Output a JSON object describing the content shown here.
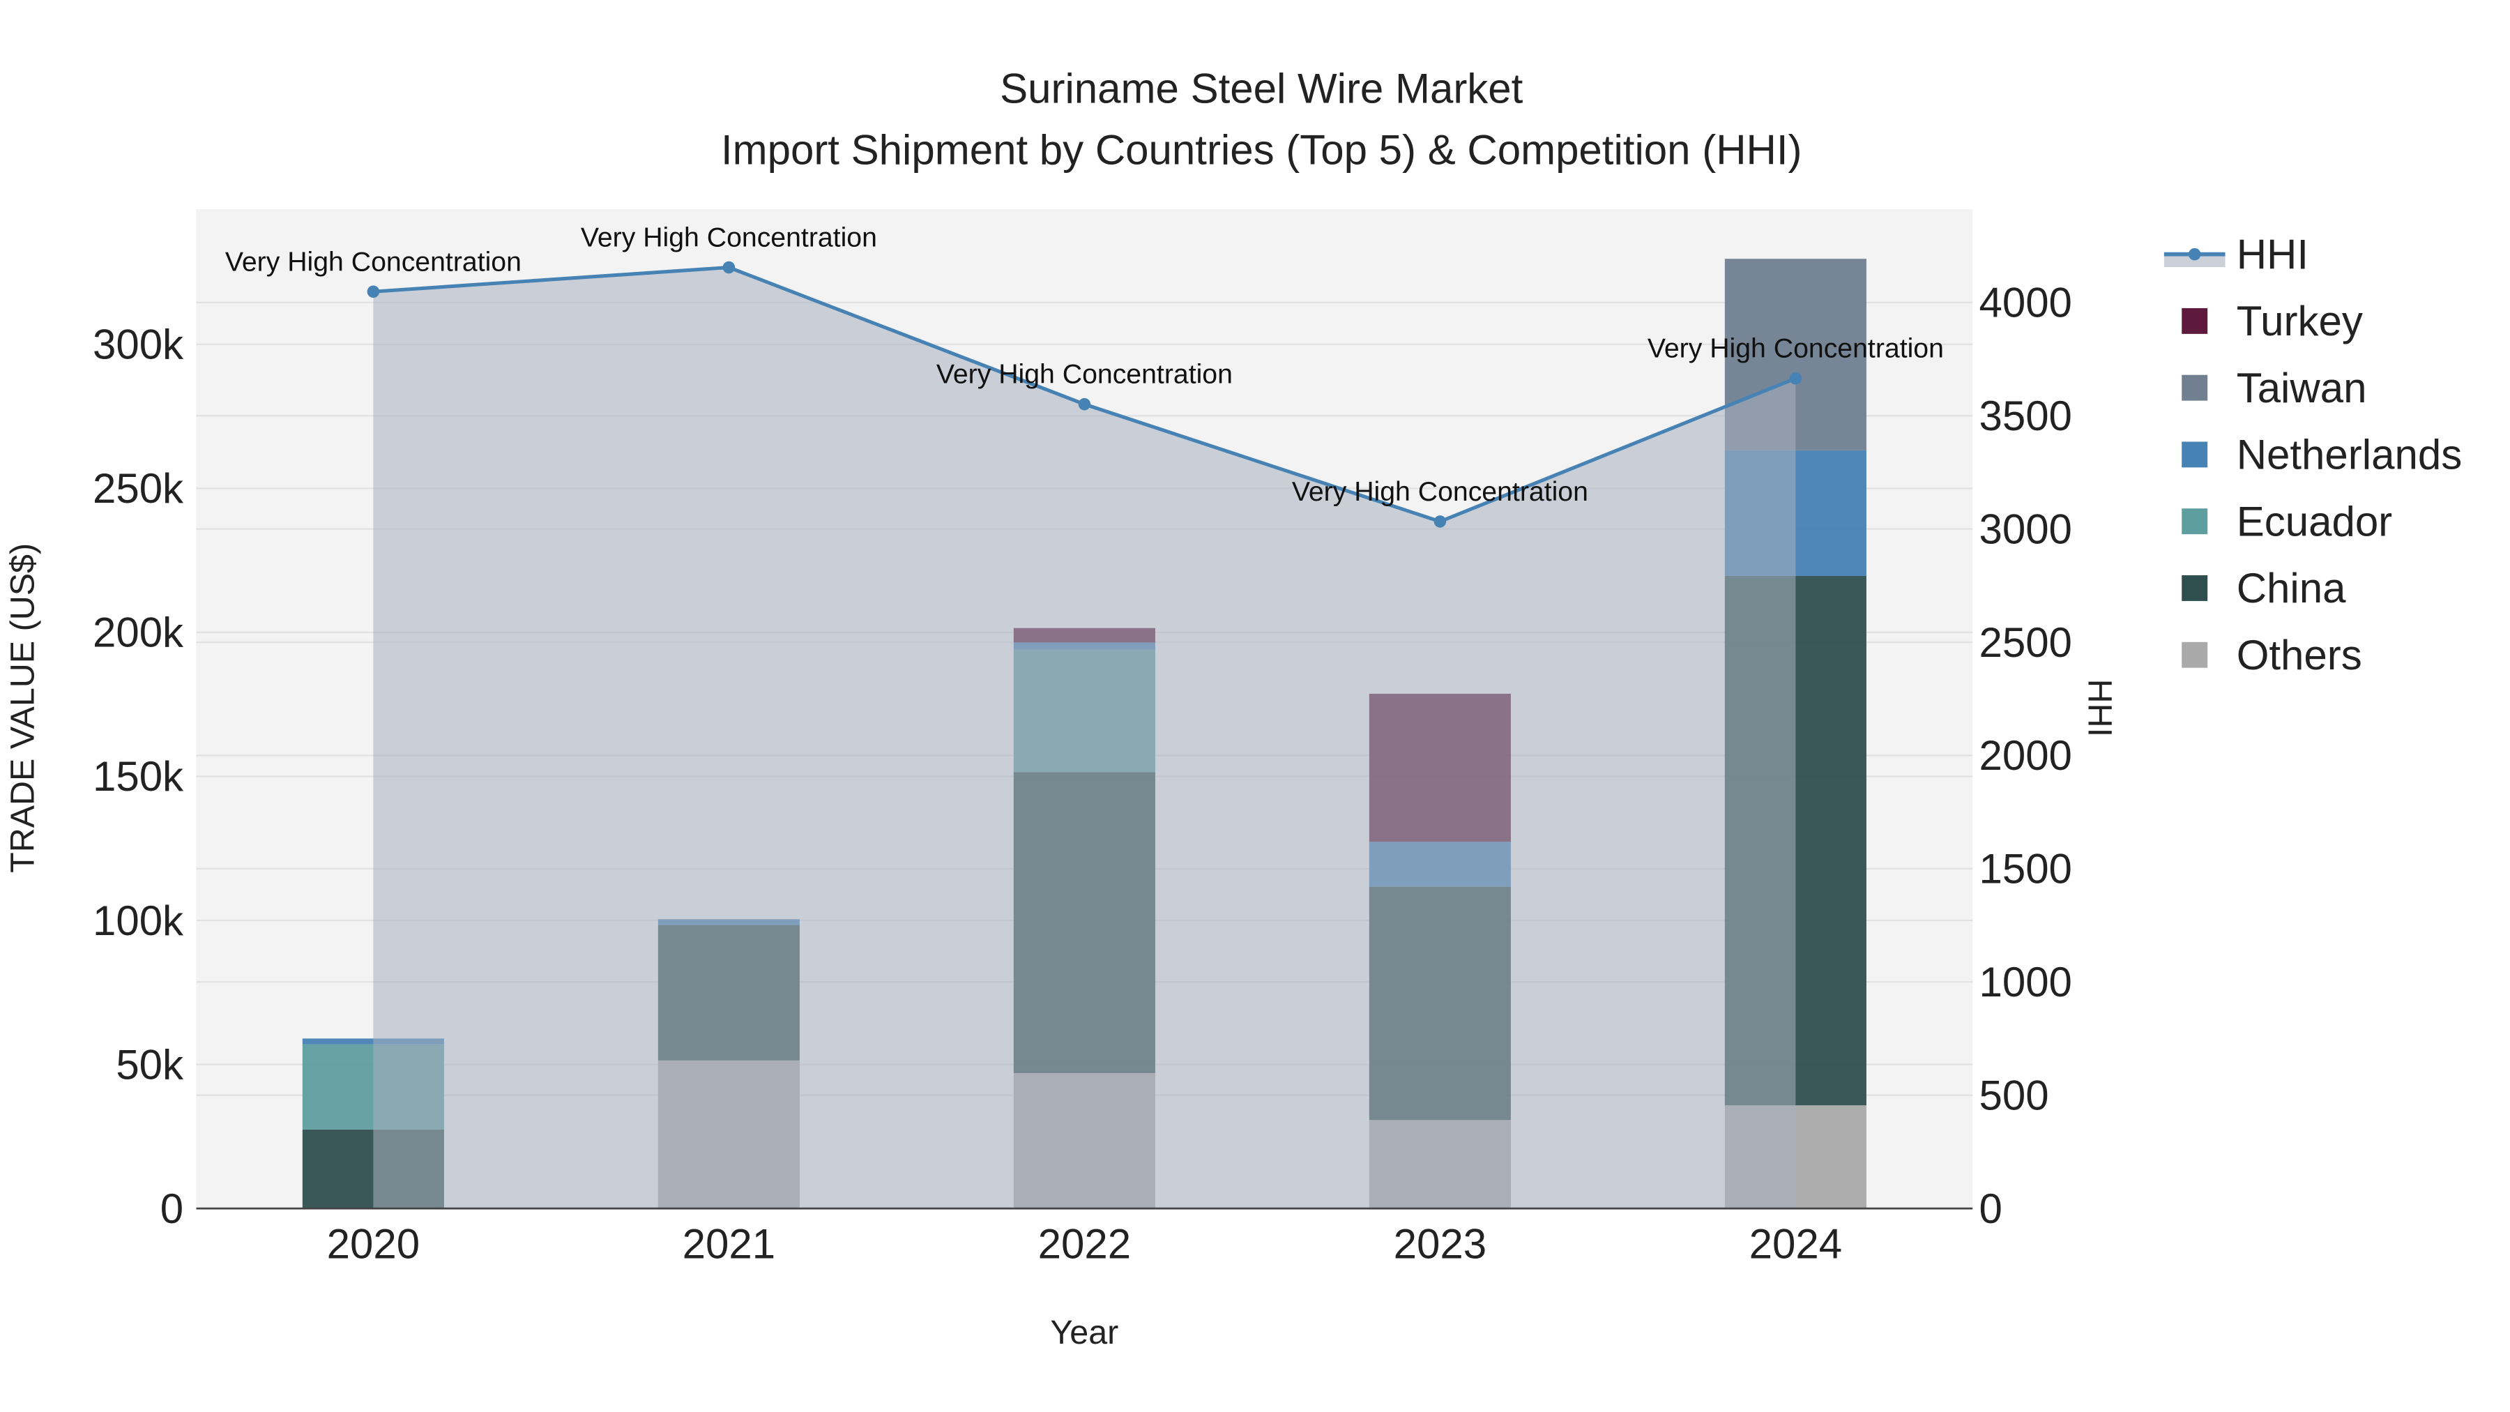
{
  "chart_data": {
    "type": "bar",
    "title": "Suriname Steel Wire Market",
    "subtitle": "Import Shipment by Countries (Top 5) & Competition (HHI)",
    "xlabel": "Year",
    "ylabel": "TRADE VALUE (US$)",
    "y2label": "HHI",
    "categories": [
      "2020",
      "2021",
      "2022",
      "2023",
      "2024"
    ],
    "ylim": [
      0,
      345000
    ],
    "y2lim": [
      0,
      4400
    ],
    "yticks": [
      0,
      50000,
      100000,
      150000,
      200000,
      250000,
      300000
    ],
    "ytick_labels": [
      "0",
      "50k",
      "100k",
      "150k",
      "200k",
      "250k",
      "300k"
    ],
    "y2ticks": [
      0,
      500,
      1000,
      1500,
      2000,
      2500,
      3000,
      3500,
      4000
    ],
    "y2tick_labels": [
      "0",
      "500",
      "1000",
      "1500",
      "2000",
      "2500",
      "3000",
      "3500",
      "4000"
    ],
    "stack_order": [
      "Others",
      "China",
      "Ecuador",
      "Netherlands",
      "Taiwan",
      "Turkey"
    ],
    "series": [
      {
        "name": "Others",
        "color": "#a9a9a9",
        "values": [
          0,
          51400,
          47000,
          30700,
          35800
        ]
      },
      {
        "name": "China",
        "color": "#2f4f4f",
        "values": [
          27400,
          47000,
          104500,
          81000,
          183800
        ]
      },
      {
        "name": "Ecuador",
        "color": "#5f9ea0",
        "values": [
          29600,
          0,
          42500,
          0,
          0
        ]
      },
      {
        "name": "Netherlands",
        "color": "#4682b4",
        "values": [
          2000,
          2000,
          2500,
          15600,
          43600
        ]
      },
      {
        "name": "Taiwan",
        "color": "#708090",
        "values": [
          0,
          0,
          0,
          0,
          66500
        ]
      },
      {
        "name": "Turkey",
        "color": "#5e1a3c",
        "values": [
          0,
          0,
          5000,
          51400,
          0
        ]
      }
    ],
    "hhi": {
      "name": "HHI",
      "color": "#4682b4",
      "values": [
        4048,
        4155,
        3551,
        3033,
        3665
      ],
      "annotations": [
        "Very High Concentration",
        "Very High Concentration",
        "Very High Concentration",
        "Very High Concentration",
        "Very High Concentration"
      ]
    },
    "legend": [
      "HHI",
      "Turkey",
      "Taiwan",
      "Netherlands",
      "Ecuador",
      "China",
      "Others"
    ],
    "legend_position": "right",
    "grid": true
  }
}
